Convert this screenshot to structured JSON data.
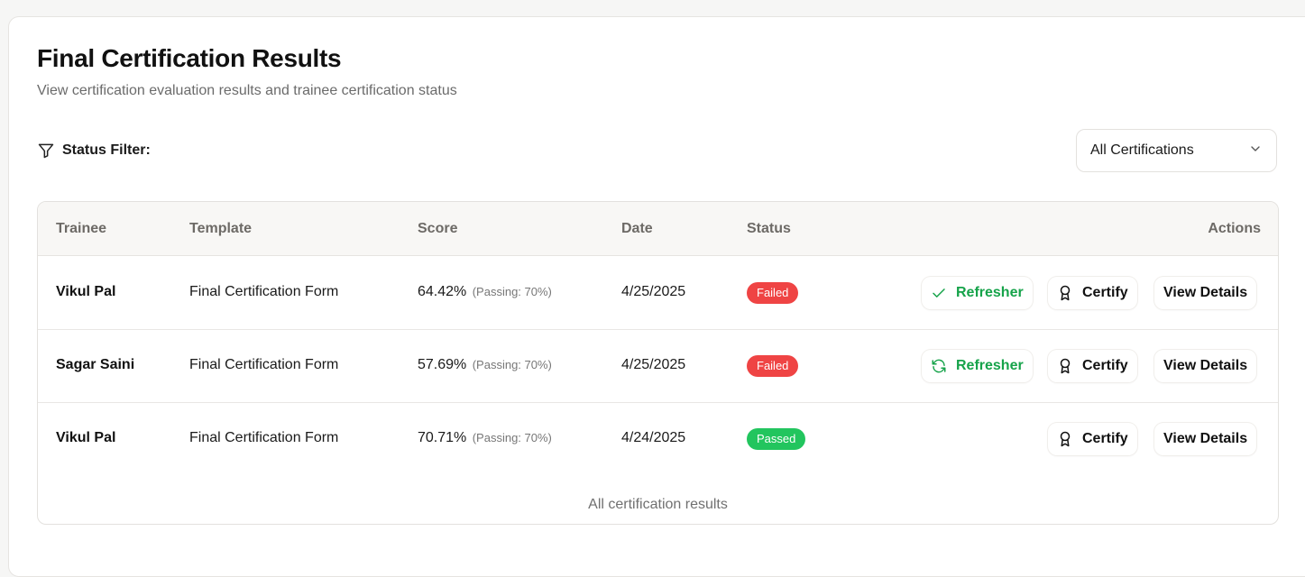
{
  "page": {
    "title": "Final Certification Results",
    "subtitle": "View certification evaluation results and trainee certification status"
  },
  "filter": {
    "label": "Status Filter:",
    "selected": "All Certifications",
    "icon": "filter-icon"
  },
  "table": {
    "headers": {
      "trainee": "Trainee",
      "template": "Template",
      "score": "Score",
      "date": "Date",
      "status": "Status",
      "actions": "Actions"
    },
    "rows": [
      {
        "trainee": "Vikul Pal",
        "template": "Final Certification Form",
        "score": "64.42%",
        "passing": "(Passing: 70%)",
        "date": "4/25/2025",
        "status": "Failed",
        "refresher_label": "Refresher",
        "refresher_icon": "check-icon",
        "certify_label": "Certify",
        "view_label": "View Details"
      },
      {
        "trainee": "Sagar Saini",
        "template": "Final Certification Form",
        "score": "57.69%",
        "passing": "(Passing: 70%)",
        "date": "4/25/2025",
        "status": "Failed",
        "refresher_label": "Refresher",
        "refresher_icon": "refresh-icon",
        "certify_label": "Certify",
        "view_label": "View Details"
      },
      {
        "trainee": "Vikul Pal",
        "template": "Final Certification Form",
        "score": "70.71%",
        "passing": "(Passing: 70%)",
        "date": "4/24/2025",
        "status": "Passed",
        "certify_label": "Certify",
        "view_label": "View Details"
      }
    ],
    "footer": "All certification results"
  },
  "colors": {
    "failed": "#ef4444",
    "passed": "#22c55e",
    "refresher": "#16a34a"
  }
}
